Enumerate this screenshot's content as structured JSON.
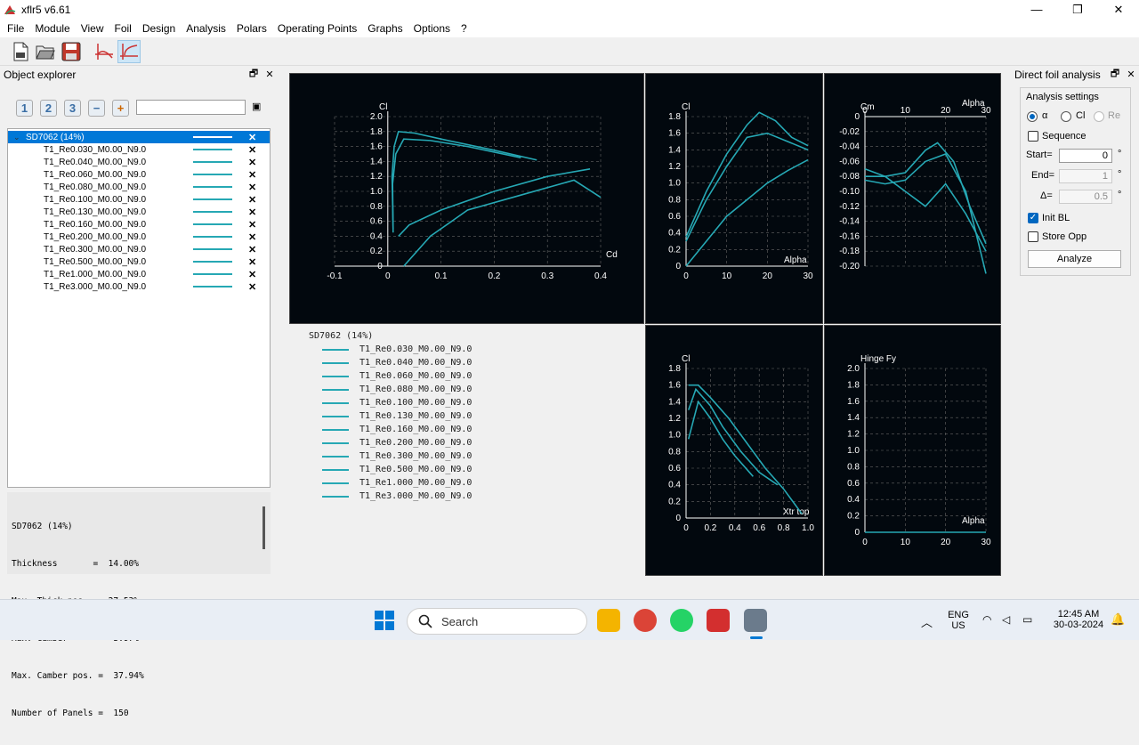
{
  "window": {
    "title": "xflr5 v6.61",
    "minimize": "—",
    "maximize": "❐",
    "close": "✕"
  },
  "menu": [
    "File",
    "Module",
    "View",
    "Foil",
    "Design",
    "Analysis",
    "Polars",
    "Operating Points",
    "Graphs",
    "Options",
    "?"
  ],
  "explorer": {
    "title": "Object explorer",
    "float": "🗗",
    "close": "✕",
    "num_buttons": [
      "1",
      "2",
      "3"
    ],
    "minus": "−",
    "plus": "+",
    "clear": "▣",
    "foil": "SD7062 (14%)",
    "polars": [
      "T1_Re0.030_M0.00_N9.0",
      "T1_Re0.040_M0.00_N9.0",
      "T1_Re0.060_M0.00_N9.0",
      "T1_Re0.080_M0.00_N9.0",
      "T1_Re0.100_M0.00_N9.0",
      "T1_Re0.130_M0.00_N9.0",
      "T1_Re0.160_M0.00_N9.0",
      "T1_Re0.200_M0.00_N9.0",
      "T1_Re0.300_M0.00_N9.0",
      "T1_Re0.500_M0.00_N9.0",
      "T1_Re1.000_M0.00_N9.0",
      "T1_Re3.000_M0.00_N9.0"
    ],
    "delete": "✕",
    "props": [
      "SD7062 (14%)",
      "Thickness       =  14.00%",
      "Max. Thick.pos. =  27.53%",
      "Max. Camber     =   3.97%",
      "Max. Camber pos. =  37.94%",
      "Number of Panels =  150"
    ]
  },
  "legend": {
    "title": "SD7062 (14%)"
  },
  "colors": {
    "curve": "#26a8b4",
    "graph_bg": "#02080e",
    "axis": "#ffffff",
    "selection": "#0078d7"
  },
  "chart_data": [
    {
      "type": "line",
      "panel": "cl_cd",
      "xlabel": "Cd",
      "ylabel": "Cl",
      "xlim": [
        -0.1,
        0.4
      ],
      "ylim": [
        0,
        2.0
      ],
      "xticks": [
        "-0.1",
        "0",
        "0.1",
        "0.2",
        "0.3",
        "0.4"
      ],
      "yticks": [
        "0",
        "0.2",
        "0.4",
        "0.6",
        "0.8",
        "1.0",
        "1.2",
        "1.4",
        "1.6",
        "1.8",
        "2.0"
      ],
      "grid": true,
      "series": [
        {
          "x": [
            0.01,
            0.008,
            0.012,
            0.02,
            0.05,
            0.1,
            0.2,
            0.28
          ],
          "y": [
            0.5,
            1.2,
            1.6,
            1.8,
            1.78,
            1.7,
            1.55,
            1.42
          ]
        },
        {
          "x": [
            0.01,
            0.009,
            0.015,
            0.03,
            0.08,
            0.15,
            0.25
          ],
          "y": [
            0.45,
            1.1,
            1.5,
            1.7,
            1.68,
            1.6,
            1.45
          ]
        },
        {
          "x": [
            0.02,
            0.04,
            0.1,
            0.2,
            0.3,
            0.38
          ],
          "y": [
            0.4,
            0.55,
            0.75,
            1.0,
            1.2,
            1.3
          ]
        },
        {
          "x": [
            0.03,
            0.08,
            0.15,
            0.25,
            0.35,
            0.4
          ],
          "y": [
            0.0,
            0.4,
            0.75,
            0.95,
            1.15,
            0.92
          ]
        }
      ]
    },
    {
      "type": "line",
      "panel": "cl_alpha",
      "xlabel": "Alpha",
      "ylabel": "Cl",
      "xlim": [
        0,
        30
      ],
      "ylim": [
        0,
        1.8
      ],
      "xticks": [
        "0",
        "10",
        "20",
        "30"
      ],
      "yticks": [
        "0",
        "0.2",
        "0.4",
        "0.6",
        "0.8",
        "1.0",
        "1.2",
        "1.4",
        "1.6",
        "1.8"
      ],
      "grid": true,
      "series": [
        {
          "x": [
            0,
            5,
            10,
            15,
            18,
            22,
            26,
            30
          ],
          "y": [
            0.35,
            0.9,
            1.35,
            1.7,
            1.85,
            1.75,
            1.55,
            1.45
          ]
        },
        {
          "x": [
            0,
            5,
            10,
            15,
            20,
            25,
            30
          ],
          "y": [
            0.3,
            0.8,
            1.2,
            1.55,
            1.6,
            1.5,
            1.4
          ]
        },
        {
          "x": [
            0,
            5,
            10,
            15,
            20,
            25,
            30
          ],
          "y": [
            0.0,
            0.3,
            0.6,
            0.8,
            1.0,
            1.15,
            1.28
          ]
        }
      ]
    },
    {
      "type": "line",
      "panel": "cm_alpha",
      "xlabel": "Alpha",
      "ylabel": "Cm",
      "xlim": [
        0,
        30
      ],
      "ylim": [
        -0.2,
        0
      ],
      "xticks": [
        "0",
        "10",
        "20",
        "30"
      ],
      "yticks": [
        "0",
        "-0.02",
        "-0.04",
        "-0.06",
        "-0.08",
        "-0.10",
        "-0.12",
        "-0.14",
        "-0.16",
        "-0.18",
        "-0.20"
      ],
      "grid": true,
      "series": [
        {
          "x": [
            0,
            5,
            10,
            15,
            18,
            22,
            26,
            30
          ],
          "y": [
            -0.07,
            -0.08,
            -0.075,
            -0.045,
            -0.035,
            -0.06,
            -0.12,
            -0.17
          ]
        },
        {
          "x": [
            0,
            5,
            10,
            15,
            20,
            25,
            30
          ],
          "y": [
            -0.085,
            -0.09,
            -0.085,
            -0.06,
            -0.05,
            -0.1,
            -0.21
          ]
        },
        {
          "x": [
            0,
            5,
            10,
            15,
            20,
            25,
            30
          ],
          "y": [
            -0.08,
            -0.08,
            -0.1,
            -0.12,
            -0.09,
            -0.13,
            -0.18
          ]
        }
      ]
    },
    {
      "type": "line",
      "panel": "cl_xtr",
      "xlabel": "Xtr top",
      "ylabel": "Cl",
      "xlim": [
        0,
        1.0
      ],
      "ylim": [
        0,
        1.8
      ],
      "xticks": [
        "0",
        "0.2",
        "0.4",
        "0.6",
        "0.8",
        "1.0"
      ],
      "yticks": [
        "0",
        "0.2",
        "0.4",
        "0.6",
        "0.8",
        "1.0",
        "1.2",
        "1.4",
        "1.6",
        "1.8"
      ],
      "grid": true,
      "series": [
        {
          "x": [
            0.02,
            0.1,
            0.2,
            0.35,
            0.5,
            0.65,
            0.8,
            0.95
          ],
          "y": [
            1.6,
            1.6,
            1.45,
            1.2,
            0.9,
            0.6,
            0.35,
            0.05
          ]
        },
        {
          "x": [
            0.02,
            0.08,
            0.2,
            0.3,
            0.45,
            0.6,
            0.75
          ],
          "y": [
            1.3,
            1.55,
            1.35,
            1.1,
            0.8,
            0.55,
            0.4
          ]
        },
        {
          "x": [
            0.02,
            0.1,
            0.2,
            0.3,
            0.4,
            0.55
          ],
          "y": [
            0.95,
            1.4,
            1.2,
            0.95,
            0.75,
            0.5
          ]
        }
      ]
    },
    {
      "type": "line",
      "panel": "hinge_alpha",
      "xlabel": "Alpha",
      "ylabel": "Hinge Fy",
      "xlim": [
        0,
        30
      ],
      "ylim": [
        0,
        2.0
      ],
      "xticks": [
        "0",
        "10",
        "20",
        "30"
      ],
      "yticks": [
        "0",
        "0.2",
        "0.4",
        "0.6",
        "0.8",
        "1.0",
        "1.2",
        "1.4",
        "1.6",
        "1.8",
        "2.0"
      ],
      "grid": true,
      "series": [
        {
          "x": [
            0,
            30
          ],
          "y": [
            0,
            0
          ]
        }
      ]
    }
  ],
  "dfa": {
    "title": "Direct foil analysis",
    "float": "🗗",
    "close": "✕",
    "group": "Analysis settings",
    "radio": [
      "α",
      "Cl",
      "Re"
    ],
    "sequence": "Sequence",
    "start_label": "Start=",
    "start_val": "0",
    "end_label": "End=",
    "end_val": "1",
    "delta_label": "Δ=",
    "delta_val": "0.5",
    "deg": "°",
    "initbl": "Init BL",
    "storeopp": "Store Opp",
    "analyze": "Analyze"
  },
  "taskbar": {
    "search": "Search",
    "lang1": "ENG",
    "lang2": "US",
    "time": "12:45 AM",
    "date": "30-03-2024"
  }
}
